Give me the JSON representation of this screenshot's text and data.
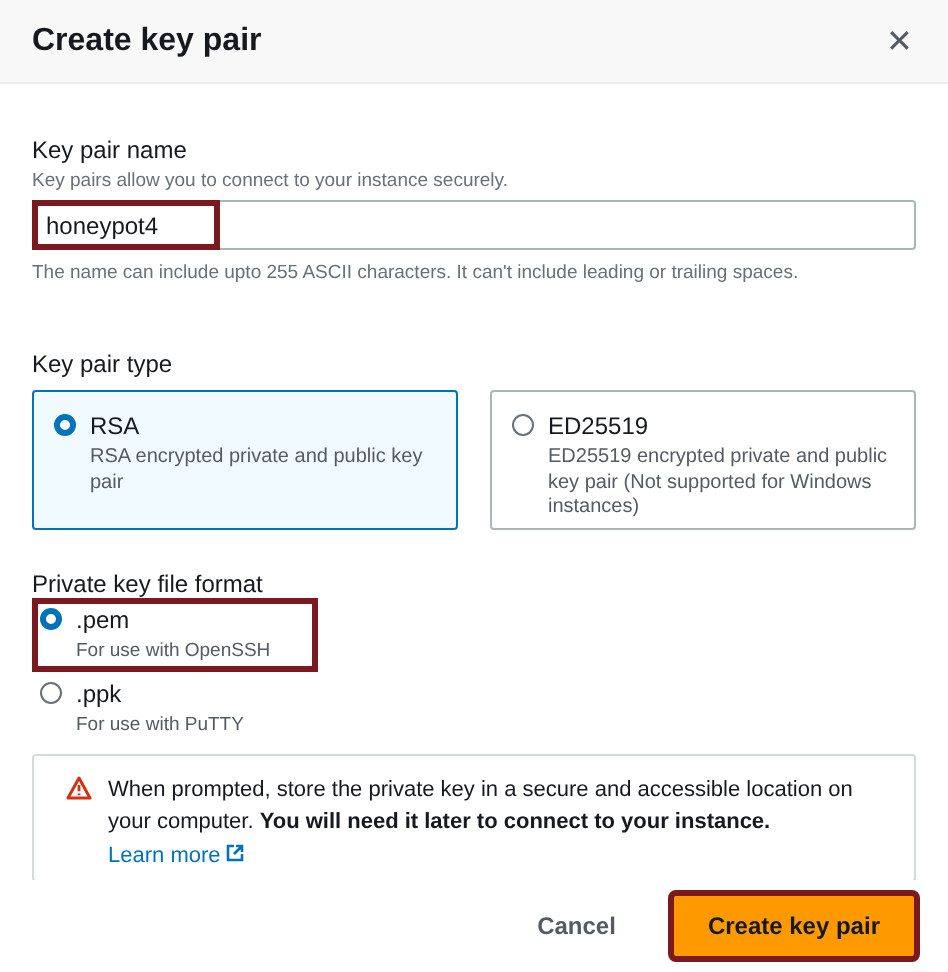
{
  "dialog": {
    "title": "Create key pair",
    "close_glyph": "✕"
  },
  "name_field": {
    "label": "Key pair name",
    "description": "Key pairs allow you to connect to your instance securely.",
    "value": "honeypot4",
    "highlighted": true,
    "hint": "The name can include upto 255 ASCII characters. It can't include leading or trailing spaces."
  },
  "type_group": {
    "label": "Key pair type",
    "options": [
      {
        "title": "RSA",
        "description": "RSA encrypted private and public key pair",
        "selected": true
      },
      {
        "title": "ED25519",
        "description": "ED25519 encrypted private and public key pair (Not supported for Windows instances)",
        "selected": false
      }
    ]
  },
  "format_group": {
    "label": "Private key file format",
    "options": [
      {
        "title": ".pem",
        "description": "For use with OpenSSH",
        "selected": true,
        "highlighted": true
      },
      {
        "title": ".ppk",
        "description": "For use with PuTTY",
        "selected": false,
        "highlighted": false
      }
    ]
  },
  "warning": {
    "text": "When prompted, store the private key in a secure and accessible location on your computer. **You will need it later to connect to your instance.**",
    "link": "Learn more"
  },
  "buttons": [
    {
      "label": "Cancel",
      "kind": "link",
      "highlighted": false
    },
    {
      "label": "Create key pair",
      "kind": "primary",
      "highlighted": true
    }
  ]
}
